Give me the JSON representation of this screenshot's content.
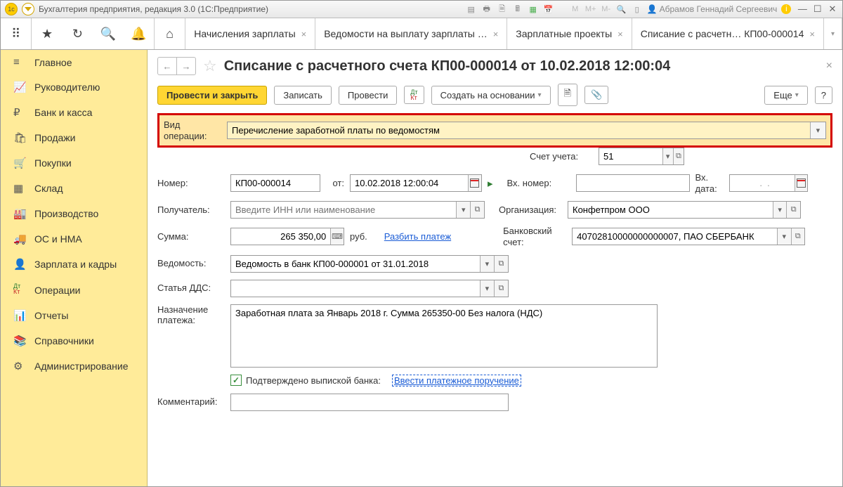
{
  "titlebar": {
    "app_title": "Бухгалтерия предприятия, редакция 3.0  (1С:Предприятие)",
    "user": "Абрамов Геннадий Сергеевич",
    "mem_labels": [
      "M",
      "M+",
      "M-"
    ]
  },
  "tabs": [
    {
      "label": "Начисления зарплаты"
    },
    {
      "label": "Ведомости на выплату зарплаты …"
    },
    {
      "label": "Зарплатные проекты"
    },
    {
      "label": "Списание с расчетн… КП00-000014",
      "active": true
    }
  ],
  "sidebar": {
    "items": [
      {
        "label": "Главное",
        "icon": "≡"
      },
      {
        "label": "Руководителю",
        "icon": "📈"
      },
      {
        "label": "Банк и касса",
        "icon": "₽"
      },
      {
        "label": "Продажи",
        "icon": "🛍"
      },
      {
        "label": "Покупки",
        "icon": "🛒"
      },
      {
        "label": "Склад",
        "icon": "▦"
      },
      {
        "label": "Производство",
        "icon": "🏭"
      },
      {
        "label": "ОС и НМА",
        "icon": "🚚"
      },
      {
        "label": "Зарплата и кадры",
        "icon": "👤"
      },
      {
        "label": "Операции",
        "icon": "ДтКт"
      },
      {
        "label": "Отчеты",
        "icon": "📊"
      },
      {
        "label": "Справочники",
        "icon": "📚"
      },
      {
        "label": "Администрирование",
        "icon": "⚙"
      }
    ]
  },
  "doc": {
    "title": "Списание с расчетного счета КП00-000014 от 10.02.2018 12:00:04",
    "cmd_post_close": "Провести и закрыть",
    "cmd_write": "Записать",
    "cmd_post": "Провести",
    "cmd_create_on": "Создать на основании",
    "cmd_more": "Еще",
    "cmd_help": "?"
  },
  "form": {
    "operation_type_label": "Вид операции:",
    "operation_type_value": "Перечисление заработной платы по ведомостям",
    "account_label": "Счет учета:",
    "account_value": "51",
    "number_label": "Номер:",
    "number_value": "КП00-000014",
    "from_label": "от:",
    "date_value": "10.02.2018 12:00:04",
    "incoming_number_label": "Вх. номер:",
    "incoming_number_value": "",
    "incoming_date_label": "Вх. дата:",
    "incoming_date_value": "  .  .",
    "recipient_label": "Получатель:",
    "recipient_placeholder": "Введите ИНН или наименование",
    "org_label": "Организация:",
    "org_value": "Конфетпром ООО",
    "amount_label": "Сумма:",
    "amount_value": "265 350,00",
    "amount_currency": "руб.",
    "split_payment": "Разбить платеж",
    "bank_account_label": "Банковский счет:",
    "bank_account_value": "40702810000000000007, ПАО СБЕРБАНК",
    "statement_label": "Ведомость:",
    "statement_value": "Ведомость в банк КП00-000001 от 31.01.2018",
    "dds_label": "Статья ДДС:",
    "dds_value": "",
    "purpose_label": "Назначение платежа:",
    "purpose_value": "Заработная плата за Январь 2018 г. Сумма 265350-00 Без налога (НДС)",
    "confirmed_label": "Подтверждено выпиской банка:",
    "enter_payment_order": "Ввести платежное поручение",
    "comment_label": "Комментарий:",
    "comment_value": ""
  }
}
